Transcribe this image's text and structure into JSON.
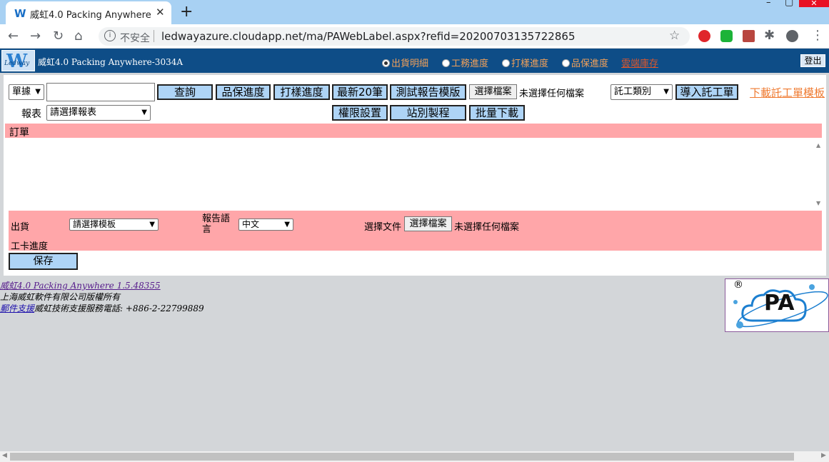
{
  "browser": {
    "tab_title": "威虹4.0 Packing Anywhere",
    "tab_favicon": "W",
    "insecure_label": "不安全",
    "url": "ledwayazure.cloudapp.net/ma/PAWebLabel.aspx?refid=20200703135722865"
  },
  "header": {
    "logo_letter": "W",
    "logo_text": "Ledway",
    "title": "威虹4.0 Packing Anywhere-3034A",
    "radio_options": [
      "出貨明細",
      "工務進度",
      "打樣進度",
      "品保進度"
    ],
    "selected_radio": "出貨明細",
    "cloud_inventory": "雲端庫存",
    "logout": "登出"
  },
  "search": {
    "type_select": "單據",
    "input_value": "",
    "report_label": "報表",
    "report_select": "請選擇報表"
  },
  "buttons": {
    "query": "查詢",
    "qa_progress": "品保進度",
    "sample_progress": "打樣進度",
    "latest20": "最新20筆",
    "test_report_template": "測試報告模版",
    "choose_file": "選擇檔案",
    "no_file": "未選擇任何檔案",
    "permissions": "權限設置",
    "station_process": "站別製程",
    "batch_download": "批量下載"
  },
  "outsource": {
    "category_select": "託工類別",
    "import_button": "導入託工單",
    "download_template": "下載託工單模板"
  },
  "orders": {
    "header": "訂單"
  },
  "shipment": {
    "label": "出貨",
    "template_select": "請選擇模板",
    "report_lang_label": "報告語言",
    "lang_select": "中文",
    "choose_doc_label": "選擇文件",
    "choose_file": "選擇檔案",
    "no_file": "未選擇任何檔案",
    "job_card_label": "工卡進度",
    "save": "保存"
  },
  "footer": {
    "version_link": "威虹4.0 Packing Anywhere 1.5.48355",
    "copyright": "上海威虹軟件有限公司版權所有",
    "mail_support": "郵件支援",
    "support_phone": "威虹技術支援服務電話: +886-2-22799889"
  },
  "pa_logo": {
    "registered": "®",
    "text": "PA"
  },
  "colors": {
    "header_bg": "#0e4d87",
    "pink_bar": "#ffa6a9",
    "button_bg": "#aed4f6",
    "link_orange": "#ef7a30"
  }
}
